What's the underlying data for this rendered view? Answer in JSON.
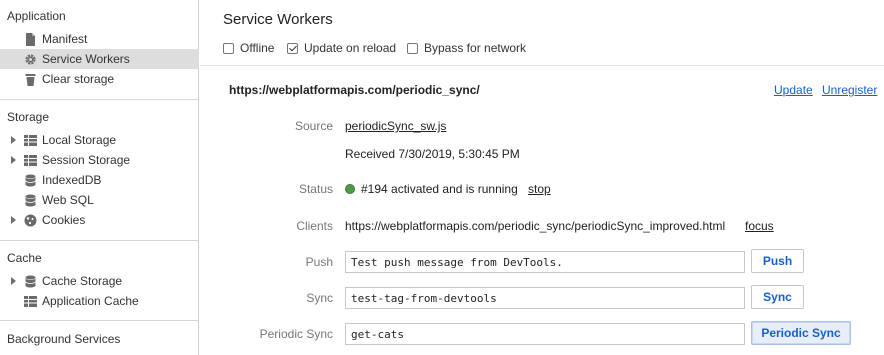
{
  "sidebar": {
    "sections": [
      {
        "title": "Application",
        "items": [
          {
            "label": "Manifest",
            "icon": "document-icon",
            "expandable": false,
            "selected": false
          },
          {
            "label": "Service Workers",
            "icon": "gear-icon",
            "expandable": false,
            "selected": true
          },
          {
            "label": "Clear storage",
            "icon": "trash-icon",
            "expandable": false,
            "selected": false
          }
        ]
      },
      {
        "title": "Storage",
        "items": [
          {
            "label": "Local Storage",
            "icon": "grid-icon",
            "expandable": true
          },
          {
            "label": "Session Storage",
            "icon": "grid-icon",
            "expandable": true
          },
          {
            "label": "IndexedDB",
            "icon": "database-icon",
            "expandable": false
          },
          {
            "label": "Web SQL",
            "icon": "database-icon",
            "expandable": false
          },
          {
            "label": "Cookies",
            "icon": "cookie-icon",
            "expandable": true
          }
        ]
      },
      {
        "title": "Cache",
        "items": [
          {
            "label": "Cache Storage",
            "icon": "database-icon",
            "expandable": true
          },
          {
            "label": "Application Cache",
            "icon": "grid-icon",
            "expandable": false
          }
        ]
      },
      {
        "title": "Background Services",
        "items": []
      }
    ]
  },
  "main": {
    "title": "Service Workers",
    "options": [
      {
        "label": "Offline",
        "checked": false
      },
      {
        "label": "Update on reload",
        "checked": true
      },
      {
        "label": "Bypass for network",
        "checked": false
      }
    ],
    "worker": {
      "url": "https://webplatformapis.com/periodic_sync/",
      "update_label": "Update",
      "unregister_label": "Unregister",
      "source_label": "Source",
      "source_file": "periodicSync_sw.js",
      "received": "Received 7/30/2019, 5:30:45 PM",
      "status_label": "Status",
      "status_text": "#194 activated and is running",
      "status_color": "#4f9a49",
      "stop_label": "stop",
      "clients_label": "Clients",
      "client_url": "https://webplatformapis.com/periodic_sync/periodicSync_improved.html",
      "focus_label": "focus",
      "push_label": "Push",
      "push_value": "Test push message from DevTools.",
      "push_button": "Push",
      "sync_label": "Sync",
      "sync_value": "test-tag-from-devtools",
      "sync_button": "Sync",
      "periodic_label": "Periodic Sync",
      "periodic_value": "get-cats",
      "periodic_button": "Periodic Sync"
    }
  },
  "colors": {
    "link": "#1a5fc9",
    "selected_bg": "#dddddd"
  }
}
